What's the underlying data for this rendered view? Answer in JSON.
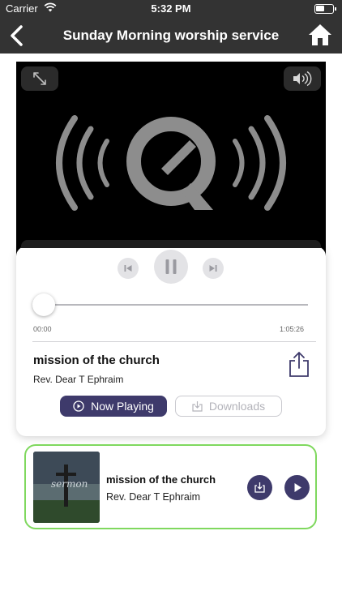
{
  "status_bar": {
    "carrier": "Carrier",
    "time": "5:32 PM"
  },
  "nav": {
    "title": "Sunday Morning worship service",
    "back_icon": "chevron-left-icon",
    "home_icon": "home-icon"
  },
  "player": {
    "expand_icon": "expand-icon",
    "volume_icon": "volume-icon",
    "logo_icon": "quicktime-logo-icon"
  },
  "controls": {
    "elapsed": "00:00",
    "duration": "1:05:26",
    "progress_fraction": 0.0
  },
  "track": {
    "title": "mission of the church",
    "artist": "Rev. Dear T Ephraim"
  },
  "buttons": {
    "now_playing": "Now Playing",
    "downloads": "Downloads"
  },
  "playlist": [
    {
      "title": "mission of the church",
      "artist": "Rev. Dear T Ephraim",
      "thumb_text": "sermon"
    }
  ],
  "colors": {
    "bar": "#333333",
    "accent": "#3e3a6b",
    "highlight_border": "#7fd85e"
  }
}
